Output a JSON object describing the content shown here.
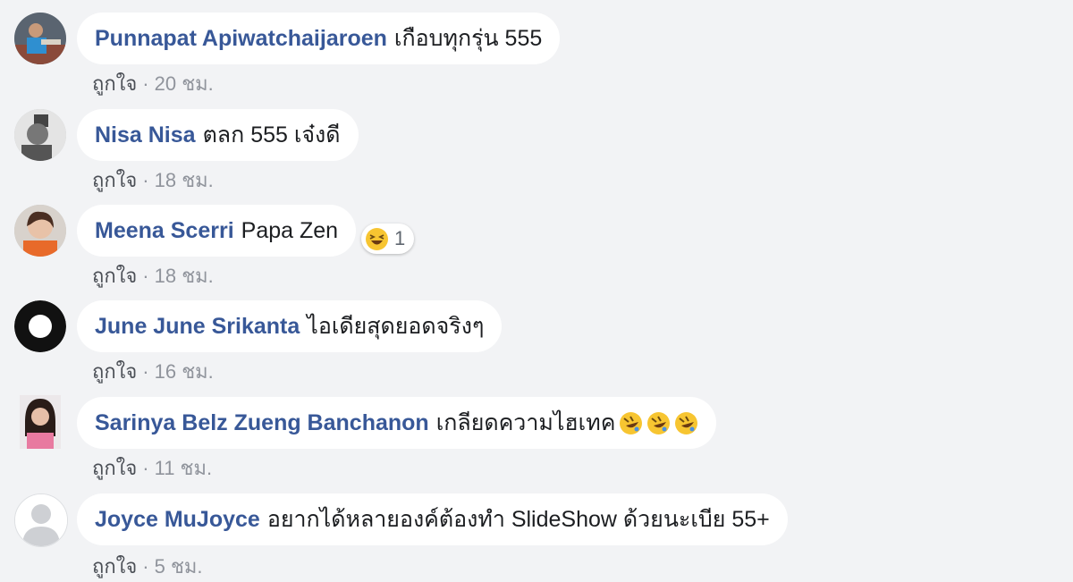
{
  "comments": [
    {
      "author": "Punnapat Apiwatchaijaroen",
      "text": "เกือบทุกรุ่น 555",
      "like": "ถูกใจ",
      "time": "20 ชม.",
      "avatar": "photo-person-guitar"
    },
    {
      "author": "Nisa Nisa",
      "text": "ตลก 555 เจ๋งดี",
      "like": "ถูกใจ",
      "time": "18 ชม.",
      "avatar": "photo-grayscale"
    },
    {
      "author": "Meena Scerri",
      "text": "Papa Zen",
      "like": "ถูกใจ",
      "time": "18 ชม.",
      "avatar": "photo-woman",
      "reaction": {
        "icon": "laughing-emoji-icon",
        "count": "1"
      }
    },
    {
      "author": "June June Srikanta",
      "text": "ไอเดียสุดยอดจริงๆ",
      "like": "ถูกใจ",
      "time": "16 ชม.",
      "avatar": "black-ring"
    },
    {
      "author": "Sarinya Belz Zueng Banchanon",
      "text": "เกลียดความไฮเทค",
      "like": "ถูกใจ",
      "time": "11 ชม.",
      "avatar": "photo-woman-dark",
      "emojis": [
        "rofl-emoji-icon",
        "rofl-emoji-icon",
        "rofl-emoji-icon"
      ]
    },
    {
      "author": "Joyce MuJoyce",
      "text": "อยากได้หลายองค์ต้องทำ SlideShow ด้วยนะเบีย 55+",
      "like": "ถูกใจ",
      "time": "5 ชม.",
      "avatar": "default-silhouette"
    }
  ],
  "separator": "·",
  "colors": {
    "background": "#f2f3f5",
    "author": "#385898",
    "meta": "#90949c",
    "bubble": "#ffffff"
  }
}
